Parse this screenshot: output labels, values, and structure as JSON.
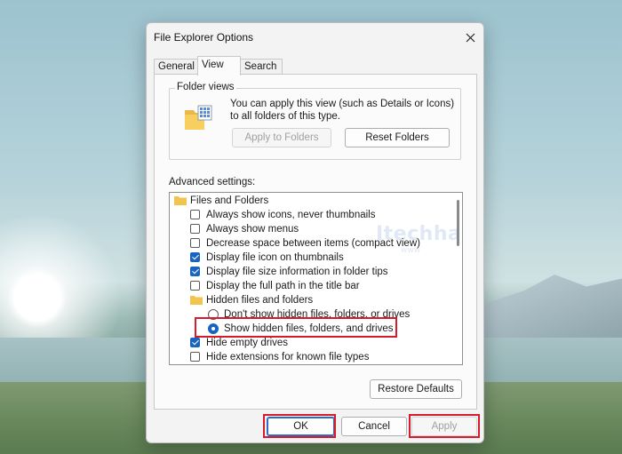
{
  "dialog": {
    "title": "File Explorer Options",
    "close_icon": "close-icon",
    "tabs": [
      {
        "label": "General",
        "active": false
      },
      {
        "label": "View",
        "active": true
      },
      {
        "label": "Search",
        "active": false
      }
    ]
  },
  "folder_views": {
    "legend": "Folder views",
    "icon": "folder-views-icon",
    "description": "You can apply this view (such as Details or Icons) to all folders of this type.",
    "apply_button": "Apply to Folders",
    "reset_button": "Reset Folders"
  },
  "advanced": {
    "label": "Advanced settings:",
    "items": [
      {
        "type": "folder",
        "label": "Files and Folders"
      },
      {
        "type": "checkbox",
        "label": "Always show icons, never thumbnails",
        "checked": false
      },
      {
        "type": "checkbox",
        "label": "Always show menus",
        "checked": false
      },
      {
        "type": "checkbox",
        "label": "Decrease space between items (compact view)",
        "checked": false
      },
      {
        "type": "checkbox",
        "label": "Display file icon on thumbnails",
        "checked": true
      },
      {
        "type": "checkbox",
        "label": "Display file size information in folder tips",
        "checked": true
      },
      {
        "type": "checkbox",
        "label": "Display the full path in the title bar",
        "checked": false
      },
      {
        "type": "folder",
        "label": "Hidden files and folders"
      },
      {
        "type": "radio",
        "label": "Don't show hidden files, folders, or drives",
        "selected": false
      },
      {
        "type": "radio",
        "label": "Show hidden files, folders, and drives",
        "selected": true
      },
      {
        "type": "checkbox",
        "label": "Hide empty drives",
        "checked": true
      },
      {
        "type": "checkbox",
        "label": "Hide extensions for known file types",
        "checked": false
      }
    ],
    "restore_button": "Restore Defaults"
  },
  "footer": {
    "ok_label": "OK",
    "cancel_label": "Cancel",
    "apply_label": "Apply"
  },
  "watermark": {
    "text": "Itechhacks.Net",
    "subtext": "www"
  },
  "colors": {
    "accent": "#1765c1",
    "highlight_box": "#d81b2a",
    "dialog_bg": "#f3f3f3"
  }
}
